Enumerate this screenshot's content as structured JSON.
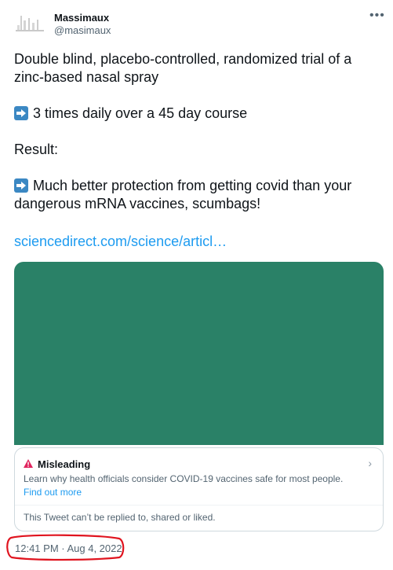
{
  "author": {
    "name": "Massimaux",
    "handle": "@masimaux",
    "avatar_icon": "avatar-image"
  },
  "more_icon": "more-options-icon",
  "tweet": {
    "line1": "Double blind, placebo-controlled, randomized trial of a zinc-based nasal spray",
    "line2": "3 times daily over a 45 day course",
    "line3": "Result:",
    "line4": "Much better protection from getting covid than your dangerous mRNA vaccines, scumbags!",
    "link": "sciencedirect.com/science/articl…",
    "arrow_icon": "right-arrow-emoji-icon",
    "arrow_color": "#3b88c3"
  },
  "media": {
    "color": "#2a8167"
  },
  "notice": {
    "icon": "warning-triangle-icon",
    "icon_color": "#e0245e",
    "title": "Misleading",
    "description": "Learn why health officials consider COVID-19 vaccines safe for most people.",
    "link": "Find out more",
    "restriction": "This Tweet can’t be replied to, shared or liked."
  },
  "timestamp": "12:41 PM · Aug 4, 2022",
  "annotation": {
    "color": "#e0141f"
  }
}
